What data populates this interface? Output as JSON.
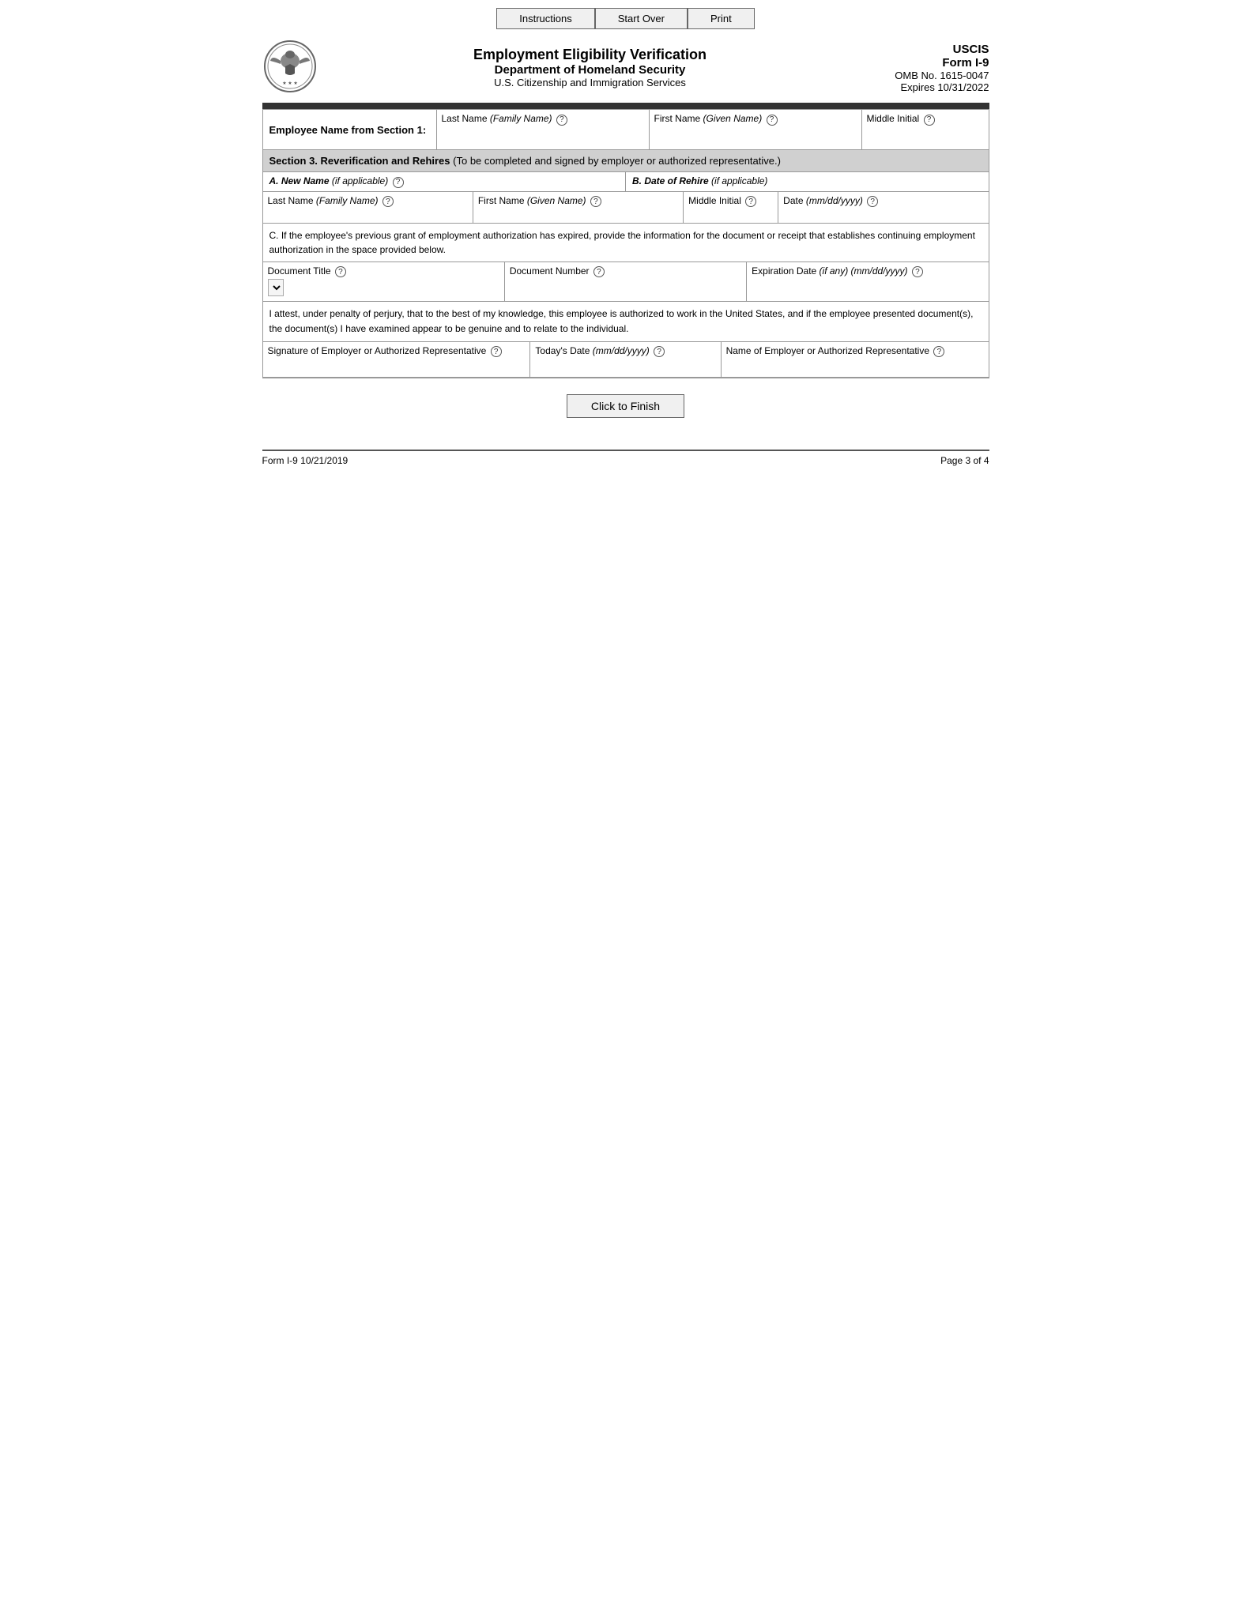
{
  "nav": {
    "instructions": "Instructions",
    "start_over": "Start Over",
    "print": "Print"
  },
  "header": {
    "main_title": "Employment Eligibility Verification",
    "sub_title": "Department of Homeland Security",
    "sub_title2": "U.S. Citizenship and Immigration Services",
    "uscis": "USCIS",
    "form_title": "Form I-9",
    "omb": "OMB No. 1615-0047",
    "expires": "Expires 10/31/2022"
  },
  "employee_name": {
    "label": "Employee Name from Section 1:",
    "last_name_label": "Last Name ",
    "last_name_italic": "(Family Name)",
    "first_name_label": "First Name ",
    "first_name_italic": "(Given Name)",
    "middle_initial_label": "Middle Initial"
  },
  "section3": {
    "title": "Section 3. Reverification and Rehires",
    "subtitle": "(To be completed and signed by employer or authorized representative.)",
    "section_a_label": "A. New Name ",
    "section_a_italic": "(if applicable)",
    "section_b_label": "B. Date of Rehire ",
    "section_b_italic": "(if applicable)",
    "last_name_label": "Last Name ",
    "last_name_italic": "(Family Name)",
    "first_name_label": "First Name ",
    "first_name_italic": "(Given Name)",
    "middle_initial_label": "Middle Initial",
    "date_label": "Date ",
    "date_italic": "(mm/dd/yyyy)"
  },
  "section_c": {
    "text": "C. If the employee's previous grant of employment authorization has expired, provide the information for the document or receipt that establishes continuing employment authorization in the space provided below.",
    "doc_title_label": "Document Title",
    "doc_number_label": "Document Number",
    "expiration_label": "Expiration Date ",
    "expiration_italic": "(if any) (mm/dd/yyyy)"
  },
  "attestation": {
    "text": "I attest, under penalty of perjury, that to the best of my knowledge, this employee is authorized to work in the United States, and if the employee presented document(s), the document(s) I have examined appear to be genuine and to relate to the individual.",
    "sig_label": "Signature of Employer or Authorized Representative",
    "date_label": "Today's Date ",
    "date_italic": "(mm/dd/yyyy)",
    "name_label": "Name of Employer or Authorized Representative"
  },
  "finish": {
    "button": "Click to Finish"
  },
  "footer": {
    "left": "Form I-9  10/21/2019",
    "right": "Page 3 of 4"
  }
}
